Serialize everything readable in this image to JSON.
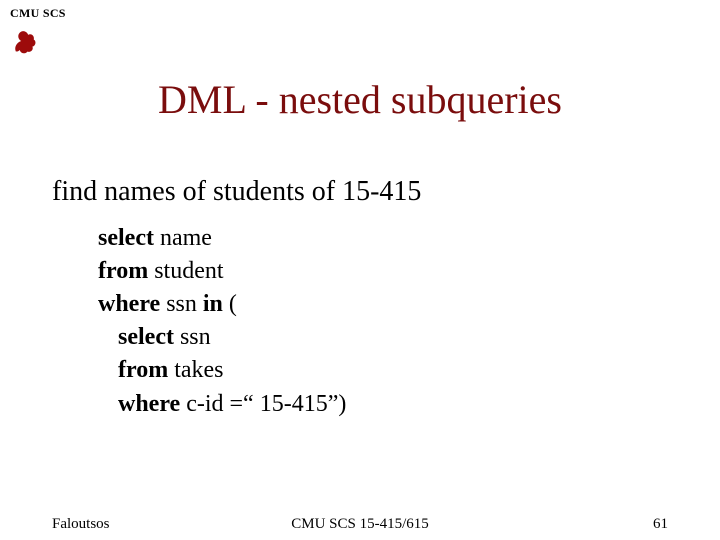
{
  "header": {
    "org": "CMU SCS",
    "logo_color": "#9d0b0b"
  },
  "title": "DML - nested subqueries",
  "subtitle": "find names of students of 15-415",
  "query": {
    "l1_kw": "select",
    "l1_rest": " name",
    "l2_kw": "from",
    "l2_rest": " student",
    "l3_kw1": "where",
    "l3_mid": "  ssn ",
    "l3_kw2": "in",
    "l3_rest": " (",
    "l4_kw": "select",
    "l4_rest": " ssn",
    "l5_kw": "from",
    "l5_rest": " takes",
    "l6_kw": "where",
    "l6_rest": "  c-id =“ 15-415”)"
  },
  "footer": {
    "left": "Faloutsos",
    "center": "CMU SCS 15-415/615",
    "right": "61"
  }
}
